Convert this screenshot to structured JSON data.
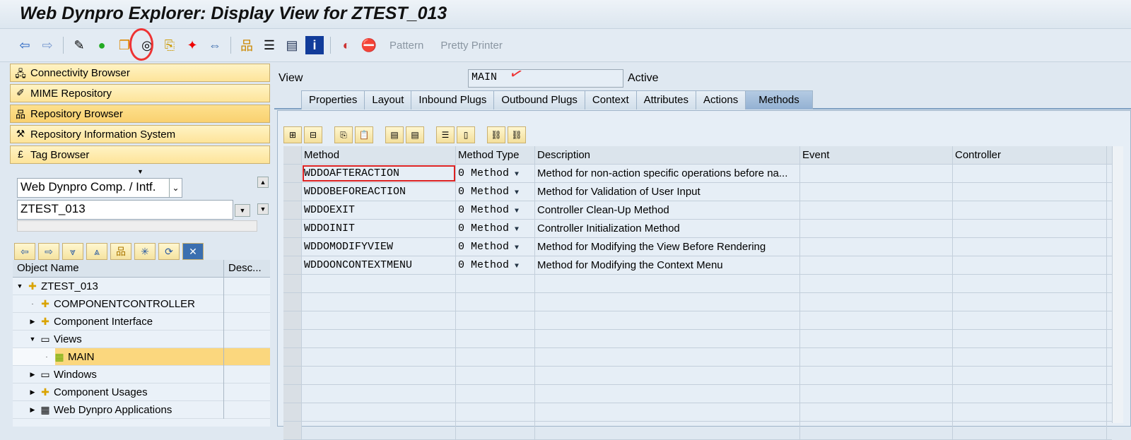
{
  "title": "Web Dynpro Explorer: Display View for ZTEST_013",
  "toolbar": {
    "pattern": "Pattern",
    "pretty_printer": "Pretty Printer"
  },
  "nav": [
    "Connectivity Browser",
    "MIME Repository",
    "Repository Browser",
    "Repository Information System",
    "Tag Browser"
  ],
  "object_type": "Web Dynpro Comp. / Intf.",
  "object_name": "ZTEST_013",
  "tree": {
    "col_name": "Object Name",
    "col_desc": "Desc...",
    "items": [
      {
        "label": "ZTEST_013"
      },
      {
        "label": "COMPONENTCONTROLLER"
      },
      {
        "label": "Component Interface"
      },
      {
        "label": "Views"
      },
      {
        "label": "MAIN"
      },
      {
        "label": "Windows"
      },
      {
        "label": "Component Usages"
      },
      {
        "label": "Web Dynpro Applications"
      }
    ]
  },
  "view": {
    "label": "View",
    "value": "MAIN",
    "status": "Active"
  },
  "tabs": [
    "Properties",
    "Layout",
    "Inbound Plugs",
    "Outbound Plugs",
    "Context",
    "Attributes",
    "Actions",
    "Methods"
  ],
  "grid": {
    "headers": [
      "Method",
      "Method Type",
      "Description",
      "Event",
      "Controller"
    ],
    "rows": [
      {
        "method": "WDDOAFTERACTION",
        "type": "0 Method",
        "desc": "Method for non-action specific operations before na..."
      },
      {
        "method": "WDDOBEFOREACTION",
        "type": "0 Method",
        "desc": "Method for Validation of User Input"
      },
      {
        "method": "WDDOEXIT",
        "type": "0 Method",
        "desc": "Controller Clean-Up Method"
      },
      {
        "method": "WDDOINIT",
        "type": "0 Method",
        "desc": "Controller Initialization Method"
      },
      {
        "method": "WDDOMODIFYVIEW",
        "type": "0 Method",
        "desc": "Method for Modifying the View Before Rendering"
      },
      {
        "method": "WDDOONCONTEXTMENU",
        "type": "0 Method",
        "desc": "Method for Modifying the Context Menu"
      }
    ]
  }
}
